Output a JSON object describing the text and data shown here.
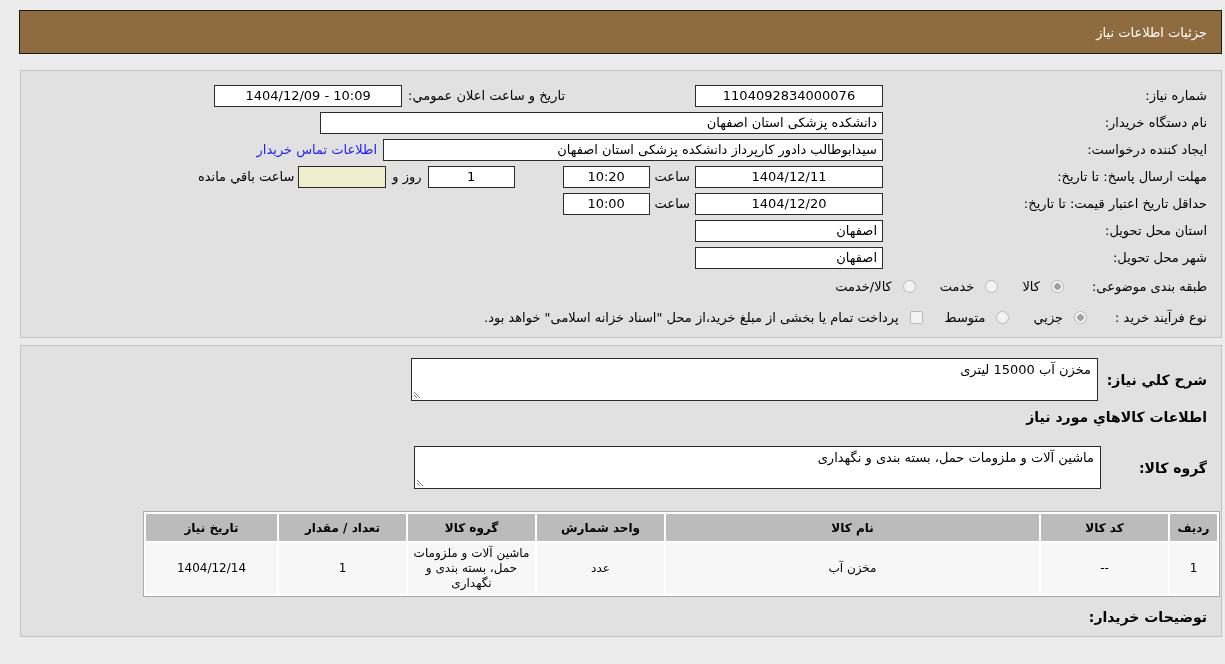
{
  "header": {
    "title": "جزئيات اطلاعات نياز"
  },
  "details": {
    "need_number": {
      "label": "شماره نياز:",
      "value": "1104092834000076"
    },
    "announcement": {
      "label": "تاريخ و ساعت اعلان عمومي:",
      "value": "1404/12/09 - 10:09"
    },
    "buyer_org": {
      "label": "نام دستگاه خريدار:",
      "value": "دانشکده پزشکی استان اصفهان"
    },
    "requester": {
      "label": "ايجاد کننده درخواست:",
      "value": "سيدابوطالب دادور کارپرداز دانشکده پزشکی استان اصفهان",
      "link": "اطلاعات تماس خريدار"
    },
    "reply_deadline": {
      "label": "مهلت ارسال پاسخ: تا تاريخ:",
      "date": "1404/12/11",
      "time_label": "ساعت",
      "time": "10:20",
      "days": "1",
      "days_label": "روز و",
      "remaining_label": "ساعت باقي مانده"
    },
    "price_validity": {
      "label": "حداقل تاريخ اعتبار قيمت: تا تاريخ:",
      "date": "1404/12/20",
      "time_label": "ساعت",
      "time": "10:00"
    },
    "delivery_province": {
      "label": "استان محل تحويل:",
      "value": "اصفهان"
    },
    "delivery_city": {
      "label": "شهر محل تحويل:",
      "value": "اصفهان"
    },
    "category": {
      "label": "طبقه بندی موضوعی:",
      "options": [
        {
          "label": "کالا",
          "selected": true
        },
        {
          "label": "خدمت",
          "selected": false
        },
        {
          "label": "کالا/خدمت",
          "selected": false
        }
      ]
    },
    "purchase_process": {
      "label": "نوع فرآيند خريد :",
      "options": [
        {
          "label": "جزيي",
          "selected": true
        },
        {
          "label": "متوسط",
          "selected": false
        }
      ],
      "treasury_payment": {
        "label": "پرداخت تمام يا بخشی از مبلغ خريد،از محل \"اسناد خزانه اسلامی\" خواهد بود.",
        "checked": false
      }
    }
  },
  "needs": {
    "summary": {
      "label": "شرح کلي نياز:",
      "value": "مخزن آب 15000 لیتری"
    },
    "goods_title": "اطلاعات کالاهاي مورد نياز",
    "goods_group": {
      "label": "گروه کالا:",
      "value": "ماشين آلات و ملزومات حمل، بسته بندی و نگهداری"
    },
    "table": {
      "columns": [
        "رديف",
        "کد کالا",
        "نام کالا",
        "واحد شمارش",
        "گروه کالا",
        "تعداد / مقدار",
        "تاريخ نياز"
      ],
      "rows": [
        {
          "cells": [
            "1",
            "--",
            "مخزن آب",
            "عدد",
            "ماشين آلات و ملزومات حمل، بسته بندی و نگهداری",
            "1",
            "1404/12/14"
          ]
        }
      ]
    },
    "buyer_notes": {
      "label": "توضيحات خريدار:"
    }
  }
}
